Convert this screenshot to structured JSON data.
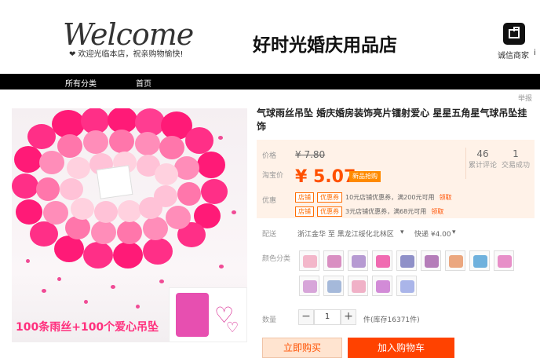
{
  "header": {
    "logo_script": "Welcome",
    "logo_sub": "❤ 欢迎光临本店，祝亲购物愉快!",
    "shop_title": "好时光婚庆用品店",
    "trust_label": "诚信商家",
    "edge_text": "i"
  },
  "nav": {
    "items": [
      "所有分类",
      "首页"
    ]
  },
  "report": "举报",
  "photo": {
    "caption": "100条雨丝+100个爱心吊坠",
    "icon_name": "product-image"
  },
  "product": {
    "title": "气球雨丝吊坠 婚庆婚房装饰亮片镭射爱心 星星五角星气球吊坠挂饰"
  },
  "price_panel": {
    "price_label": "价格",
    "old_price": "¥ 7.80",
    "taobao_label": "淘宝价",
    "price": "¥ 5.07",
    "promo": "新品抢购",
    "stats": [
      {
        "num": "46",
        "name": "累计评论"
      },
      {
        "num": "1",
        "name": "交易成功"
      }
    ],
    "coupon_label": "优惠",
    "coupons": [
      {
        "tags": [
          "店铺",
          "优惠券"
        ],
        "text": "10元店铺优惠券，满200元可用",
        "link": "领取"
      },
      {
        "tags": [
          "店铺",
          "优惠券"
        ],
        "text": "3元店铺优惠券，满68元可用",
        "link": "领取"
      }
    ]
  },
  "delivery": {
    "label": "配送",
    "from": "浙江金华 至 黑龙江绥化北林区",
    "express": "快递 ¥4.00"
  },
  "color": {
    "label": "颜色分类",
    "swatches": [
      "#f3b7ca",
      "#d98fc2",
      "#b69ad2",
      "#f06ab1",
      "#8f90c8",
      "#b57db9",
      "#eba77f",
      "#6fb1dd",
      "#e78fc8",
      "#d7a5d9",
      "#a5b9da",
      "#f0b1c7",
      "#d28bd7",
      "#aab5e9"
    ]
  },
  "quantity": {
    "label": "数量",
    "minus": "−",
    "value": "1",
    "plus": "+",
    "stock": "件(库存16371件)"
  },
  "actions": {
    "buy": "立即购买",
    "cart": "加入购物车"
  },
  "colors": {
    "accent": "#ff5000",
    "pink": "#ff2f7d",
    "nav": "#000000"
  }
}
